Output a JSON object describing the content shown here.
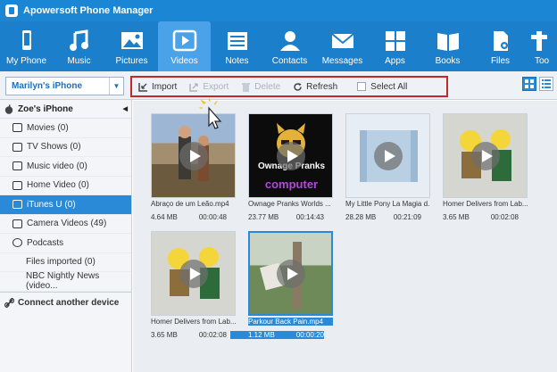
{
  "app": {
    "title": "Apowersoft Phone Manager"
  },
  "nav": [
    {
      "label": "My Phone",
      "icon": "phone-icon"
    },
    {
      "label": "Music",
      "icon": "music-icon"
    },
    {
      "label": "Pictures",
      "icon": "pictures-icon"
    },
    {
      "label": "Videos",
      "icon": "videos-icon",
      "active": true
    },
    {
      "label": "Notes",
      "icon": "notes-icon"
    },
    {
      "label": "Contacts",
      "icon": "contacts-icon"
    },
    {
      "label": "Messages",
      "icon": "messages-icon"
    },
    {
      "label": "Apps",
      "icon": "apps-icon"
    },
    {
      "label": "Books",
      "icon": "books-icon"
    },
    {
      "label": "Files",
      "icon": "files-icon"
    },
    {
      "label": "Too",
      "icon": "tools-icon"
    }
  ],
  "device_select": {
    "value": "Marilyn's iPhone"
  },
  "toolbar": {
    "import": "Import",
    "export": "Export",
    "delete": "Delete",
    "refresh": "Refresh",
    "select_all": "Select All"
  },
  "sidebar": {
    "device_name": "Zoe's iPhone",
    "items": [
      {
        "label": "Movies (0)",
        "icon": "movie-icon"
      },
      {
        "label": "TV Shows (0)",
        "icon": "tv-icon"
      },
      {
        "label": "Music video (0)",
        "icon": "music-video-icon"
      },
      {
        "label": "Home Video (0)",
        "icon": "home-video-icon"
      },
      {
        "label": "iTunes U (0)",
        "icon": "itunes-u-icon",
        "active": true
      },
      {
        "label": "Camera Videos (49)",
        "icon": "camera-icon"
      },
      {
        "label": "Podcasts",
        "icon": "podcast-icon"
      },
      {
        "label": "Files imported (0)"
      },
      {
        "label": "NBC Nightly News (video..."
      }
    ],
    "connect": "Connect another device"
  },
  "videos": [
    {
      "name": "Abraço de um Leão.mp4",
      "size": "4.64 MB",
      "duration": "00:00:48"
    },
    {
      "name": "Ownage Pranks Worlds ...",
      "size": "23.77 MB",
      "duration": "00:14:43"
    },
    {
      "name": "My Little Pony La Magia d...",
      "size": "28.28 MB",
      "duration": "00:21:09"
    },
    {
      "name": "Homer Delivers from Lab...",
      "size": "3.65 MB",
      "duration": "00:02:08"
    },
    {
      "name": "Homer Delivers from Lab...",
      "size": "3.65 MB",
      "duration": "00:02:08"
    },
    {
      "name": "Parkour Back Pain.mp4",
      "size": "1.12 MB",
      "duration": "00:00:20",
      "selected": true
    }
  ],
  "thumb_text": {
    "line1": "Ownage Pranks",
    "line2": "computer"
  },
  "colors": {
    "accent": "#1c7fcb",
    "selected": "#2a8ad7",
    "highlight_box": "#c0282c"
  }
}
